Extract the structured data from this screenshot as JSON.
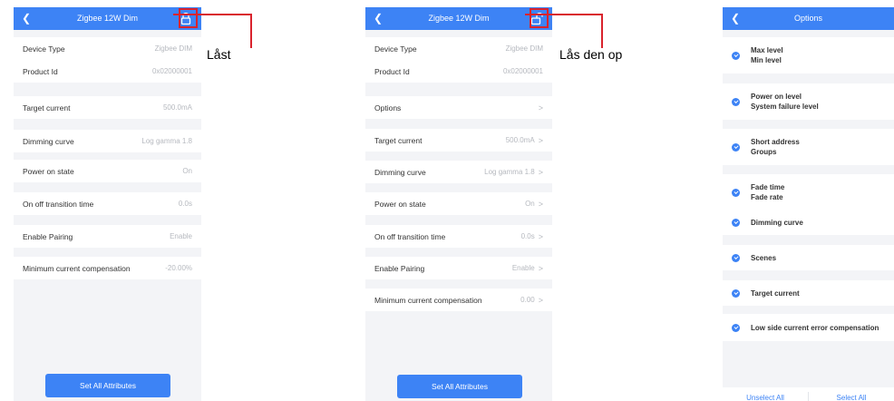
{
  "panels": {
    "locked": {
      "title": "Zigbee 12W Dim",
      "rows": [
        {
          "label": "Device Type",
          "value": "Zigbee DIM"
        },
        {
          "label": "Product Id",
          "value": "0x02000001"
        },
        {
          "label": "Target current",
          "value": "500.0mA"
        },
        {
          "label": "Dimming curve",
          "value": "Log gamma 1.8"
        },
        {
          "label": "Power on state",
          "value": "On"
        },
        {
          "label": "On off transition time",
          "value": "0.0s"
        },
        {
          "label": "Enable Pairing",
          "value": "Enable"
        },
        {
          "label": "Minimum current compensation",
          "value": "-20.00%"
        }
      ],
      "button": "Set All Attributes"
    },
    "unlocked": {
      "title": "Zigbee 12W Dim",
      "rows": [
        {
          "label": "Device Type",
          "value": "Zigbee DIM"
        },
        {
          "label": "Product Id",
          "value": "0x02000001"
        },
        {
          "label": "Options",
          "value": ""
        },
        {
          "label": "Target current",
          "value": "500.0mA"
        },
        {
          "label": "Dimming curve",
          "value": "Log gamma 1.8"
        },
        {
          "label": "Power on state",
          "value": "On"
        },
        {
          "label": "On off transition time",
          "value": "0.0s"
        },
        {
          "label": "Enable Pairing",
          "value": "Enable"
        },
        {
          "label": "Minimum current compensation",
          "value": "0.00"
        }
      ],
      "chevron": ">",
      "button": "Set All Attributes"
    },
    "options": {
      "title": "Options",
      "items": [
        {
          "line1": "Max level",
          "line2": "Min level"
        },
        {
          "line1": "Power on level",
          "line2": "System failure level"
        },
        {
          "line1": "Short address",
          "line2": "Groups"
        },
        {
          "line1": "Fade time",
          "line2": "Fade rate"
        },
        {
          "line1": "Dimming curve"
        },
        {
          "line1": "Scenes"
        },
        {
          "line1": "Target current"
        },
        {
          "line1": "Low side current error compensation"
        }
      ],
      "footer": {
        "unselect": "Unselect All",
        "select": "Select All"
      }
    }
  },
  "annotations": {
    "locked": "Låst",
    "unlocked": "Lås den op"
  },
  "icons": {
    "back": "back-chevron-icon",
    "lock": "lock-icon",
    "unlock": "unlock-icon",
    "check": "check-circle-icon"
  },
  "colors": {
    "primary": "#3d83f5",
    "highlight": "#d9232d",
    "background": "#f3f4f7"
  }
}
